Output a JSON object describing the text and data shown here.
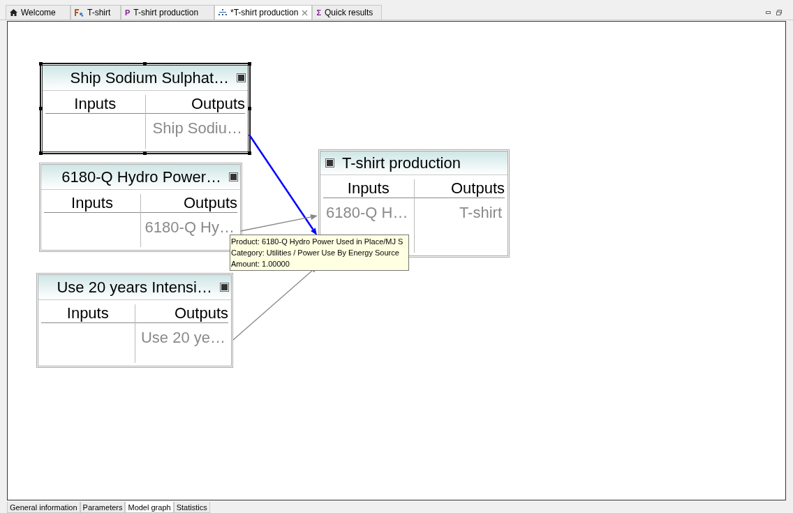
{
  "editor_tabs": [
    {
      "label": "Welcome",
      "kind": "home",
      "selected": false
    },
    {
      "label": "T-shirt",
      "kind": "flow",
      "selected": false
    },
    {
      "label": "T-shirt production",
      "kind": "letter",
      "glyph": "P",
      "selected": false
    },
    {
      "label": "*T-shirt production",
      "kind": "graph",
      "selected": true,
      "closable": true
    },
    {
      "label": "Quick results",
      "kind": "letter",
      "glyph": "Σ",
      "selected": false
    }
  ],
  "nodes": [
    {
      "title": "Ship Sodium Sulphat…",
      "kind": "provider",
      "selected": true,
      "inputs_label": "Inputs",
      "outputs_label": "Outputs",
      "outputs": [
        "Ship Sodiu…"
      ]
    },
    {
      "title": "6180-Q Hydro Power…",
      "kind": "provider",
      "selected": false,
      "inputs_label": "Inputs",
      "outputs_label": "Outputs",
      "outputs": [
        "6180-Q Hy…"
      ]
    },
    {
      "title": "Use 20 years Intensi…",
      "kind": "provider",
      "selected": false,
      "inputs_label": "Inputs",
      "outputs_label": "Outputs",
      "outputs": [
        "Use 20 ye…"
      ]
    },
    {
      "title": "T-shirt production",
      "kind": "reference",
      "selected": false,
      "inputs_label": "Inputs",
      "outputs_label": "Outputs",
      "inputs": [
        "6180-Q H…"
      ],
      "outputs": [
        "T-shirt"
      ]
    }
  ],
  "connections": [
    {
      "selected": true
    },
    {
      "selected": false
    },
    {
      "selected": false
    }
  ],
  "tooltip": [
    "Product: 6180-Q Hydro Power Used in Place/MJ S",
    "Category: Utilities / Power Use By Energy Source",
    "Amount: 1.00000"
  ],
  "page_tabs": [
    {
      "label": "General information",
      "selected": false
    },
    {
      "label": "Parameters",
      "selected": false
    },
    {
      "label": "Model graph",
      "selected": true
    },
    {
      "label": "Statistics",
      "selected": false
    }
  ]
}
